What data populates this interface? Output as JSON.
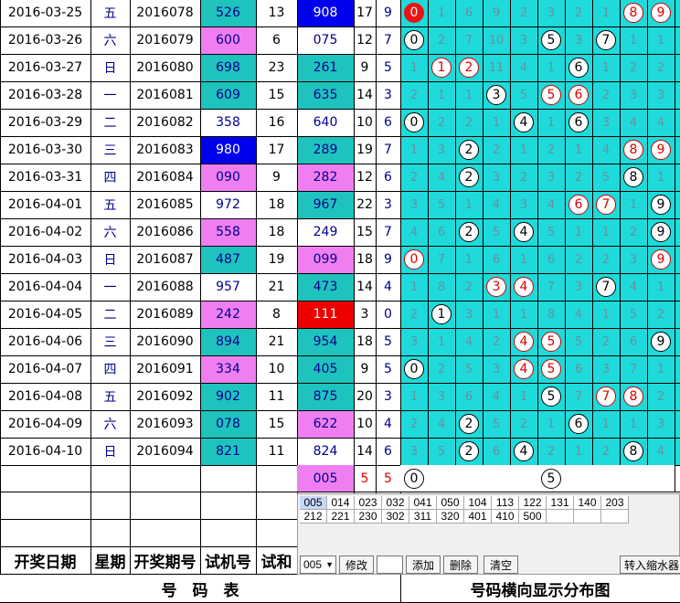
{
  "rows": [
    {
      "date": "2016-03-25",
      "weekday": "五",
      "issue": "2016078",
      "trial": "526",
      "sum": "13",
      "draw": "908",
      "s1": "17",
      "s2": "9",
      "trial_bg": "cyan",
      "draw_bg": "blue",
      "dist": [
        "0",
        "1",
        "6",
        "9",
        "2",
        "3",
        "2",
        "1",
        "8",
        "9"
      ],
      "marks": {
        "0": "fill",
        "8": "red",
        "9": "red"
      }
    },
    {
      "date": "2016-03-26",
      "weekday": "六",
      "issue": "2016079",
      "trial": "600",
      "sum": "6",
      "draw": "075",
      "s1": "12",
      "s2": "7",
      "trial_bg": "pink",
      "draw_bg": "none",
      "dist": [
        "0",
        "2",
        "7",
        "10",
        "3",
        "5",
        "3",
        "7",
        "1",
        "1"
      ],
      "marks": {
        "0": "black",
        "5": "black",
        "7": "black"
      }
    },
    {
      "date": "2016-03-27",
      "weekday": "日",
      "issue": "2016080",
      "trial": "698",
      "sum": "23",
      "draw": "261",
      "s1": "9",
      "s2": "5",
      "trial_bg": "cyan",
      "draw_bg": "cyan",
      "dist": [
        "1",
        "1",
        "2",
        "11",
        "4",
        "1",
        "6",
        "1",
        "2",
        "2"
      ],
      "marks": {
        "1": "red",
        "2": "red",
        "6": "black"
      }
    },
    {
      "date": "2016-03-28",
      "weekday": "一",
      "issue": "2016081",
      "trial": "609",
      "sum": "15",
      "draw": "635",
      "s1": "14",
      "s2": "3",
      "trial_bg": "cyan",
      "draw_bg": "cyan",
      "dist": [
        "2",
        "1",
        "1",
        "3",
        "5",
        "5",
        "6",
        "2",
        "3",
        "3"
      ],
      "marks": {
        "3": "black",
        "5": "red",
        "6": "red"
      }
    },
    {
      "date": "2016-03-29",
      "weekday": "二",
      "issue": "2016082",
      "trial": "358",
      "sum": "16",
      "draw": "640",
      "s1": "10",
      "s2": "6",
      "trial_bg": "none",
      "draw_bg": "none",
      "dist": [
        "0",
        "2",
        "2",
        "1",
        "4",
        "1",
        "6",
        "3",
        "4",
        "4"
      ],
      "marks": {
        "0": "black",
        "4": "black",
        "6": "black"
      }
    },
    {
      "date": "2016-03-30",
      "weekday": "三",
      "issue": "2016083",
      "trial": "980",
      "sum": "17",
      "draw": "289",
      "s1": "19",
      "s2": "7",
      "trial_bg": "blue",
      "draw_bg": "cyan",
      "dist": [
        "1",
        "3",
        "2",
        "2",
        "1",
        "2",
        "1",
        "4",
        "8",
        "9"
      ],
      "marks": {
        "2": "black",
        "8": "red",
        "9": "red"
      }
    },
    {
      "date": "2016-03-31",
      "weekday": "四",
      "issue": "2016084",
      "trial": "090",
      "sum": "9",
      "draw": "282",
      "s1": "12",
      "s2": "6",
      "trial_bg": "pink",
      "draw_bg": "pink",
      "dist": [
        "2",
        "4",
        "2",
        "3",
        "2",
        "3",
        "2",
        "5",
        "8",
        "1"
      ],
      "marks": {
        "2": "black",
        "8": "black"
      }
    },
    {
      "date": "2016-04-01",
      "weekday": "五",
      "issue": "2016085",
      "trial": "972",
      "sum": "18",
      "draw": "967",
      "s1": "22",
      "s2": "3",
      "trial_bg": "none",
      "draw_bg": "cyan",
      "dist": [
        "3",
        "5",
        "1",
        "4",
        "3",
        "4",
        "6",
        "7",
        "1",
        "9"
      ],
      "marks": {
        "6": "red",
        "7": "red",
        "9": "black"
      }
    },
    {
      "date": "2016-04-02",
      "weekday": "六",
      "issue": "2016086",
      "trial": "558",
      "sum": "18",
      "draw": "249",
      "s1": "15",
      "s2": "7",
      "trial_bg": "pink",
      "draw_bg": "none",
      "dist": [
        "4",
        "6",
        "2",
        "5",
        "4",
        "5",
        "1",
        "1",
        "2",
        "9"
      ],
      "marks": {
        "2": "black",
        "4": "black",
        "9": "black"
      }
    },
    {
      "date": "2016-04-03",
      "weekday": "日",
      "issue": "2016087",
      "trial": "487",
      "sum": "19",
      "draw": "099",
      "s1": "18",
      "s2": "9",
      "trial_bg": "cyan",
      "draw_bg": "pink",
      "dist": [
        "0",
        "7",
        "1",
        "6",
        "1",
        "6",
        "2",
        "2",
        "3",
        "9"
      ],
      "marks": {
        "0": "red",
        "9": "red"
      }
    },
    {
      "date": "2016-04-04",
      "weekday": "一",
      "issue": "2016088",
      "trial": "957",
      "sum": "21",
      "draw": "473",
      "s1": "14",
      "s2": "4",
      "trial_bg": "none",
      "draw_bg": "cyan",
      "dist": [
        "1",
        "8",
        "2",
        "3",
        "4",
        "7",
        "3",
        "7",
        "4",
        "1"
      ],
      "marks": {
        "3": "red",
        "4": "red",
        "7": "black"
      }
    },
    {
      "date": "2016-04-05",
      "weekday": "二",
      "issue": "2016089",
      "trial": "242",
      "sum": "8",
      "draw": "111",
      "s1": "3",
      "s2": "0",
      "trial_bg": "pink",
      "draw_bg": "red",
      "dist": [
        "2",
        "1",
        "3",
        "1",
        "1",
        "8",
        "4",
        "1",
        "5",
        "2"
      ],
      "marks": {
        "1": "black"
      }
    },
    {
      "date": "2016-04-06",
      "weekday": "三",
      "issue": "2016090",
      "trial": "894",
      "sum": "21",
      "draw": "954",
      "s1": "18",
      "s2": "5",
      "trial_bg": "cyan",
      "draw_bg": "cyan",
      "dist": [
        "3",
        "1",
        "4",
        "2",
        "4",
        "5",
        "5",
        "2",
        "6",
        "9"
      ],
      "marks": {
        "4": "red",
        "5": "red",
        "9": "black"
      }
    },
    {
      "date": "2016-04-07",
      "weekday": "四",
      "issue": "2016091",
      "trial": "334",
      "sum": "10",
      "draw": "405",
      "s1": "9",
      "s2": "5",
      "trial_bg": "pink",
      "draw_bg": "cyan",
      "dist": [
        "0",
        "2",
        "5",
        "3",
        "4",
        "5",
        "6",
        "3",
        "7",
        "1"
      ],
      "marks": {
        "0": "black",
        "4": "red",
        "5": "red"
      }
    },
    {
      "date": "2016-04-08",
      "weekday": "五",
      "issue": "2016092",
      "trial": "902",
      "sum": "11",
      "draw": "875",
      "s1": "20",
      "s2": "3",
      "trial_bg": "cyan",
      "draw_bg": "cyan",
      "dist": [
        "1",
        "3",
        "6",
        "4",
        "1",
        "5",
        "7",
        "7",
        "8",
        "2"
      ],
      "marks": {
        "5": "black",
        "7": "red",
        "8": "red"
      }
    },
    {
      "date": "2016-04-09",
      "weekday": "六",
      "issue": "2016093",
      "trial": "078",
      "sum": "15",
      "draw": "622",
      "s1": "10",
      "s2": "4",
      "trial_bg": "cyan",
      "draw_bg": "pink",
      "dist": [
        "2",
        "4",
        "2",
        "5",
        "2",
        "1",
        "6",
        "1",
        "1",
        "3"
      ],
      "marks": {
        "2": "black",
        "6": "black"
      }
    },
    {
      "date": "2016-04-10",
      "weekday": "日",
      "issue": "2016094",
      "trial": "821",
      "sum": "11",
      "draw": "824",
      "s1": "14",
      "s2": "6",
      "trial_bg": "cyan",
      "draw_bg": "none",
      "dist": [
        "3",
        "5",
        "2",
        "6",
        "4",
        "2",
        "1",
        "2",
        "8",
        "4"
      ],
      "marks": {
        "2": "black",
        "4": "black",
        "8": "black"
      }
    }
  ],
  "pending": {
    "draw": "005",
    "s1": "5",
    "s2": "5",
    "dist": [
      "0",
      "",
      "",
      "",
      "",
      "5",
      "",
      "",
      "",
      ""
    ],
    "marks": {
      "0": "black",
      "5": "black"
    }
  },
  "panel": {
    "row1": [
      "005",
      "014",
      "023",
      "032",
      "041",
      "050",
      "104",
      "113",
      "122",
      "131",
      "140",
      "203"
    ],
    "row2": [
      "212",
      "221",
      "230",
      "302",
      "311",
      "320",
      "401",
      "410",
      "500",
      "",
      "",
      ""
    ],
    "select_value": "005",
    "modify_label": "修改",
    "add_label": "添加",
    "delete_label": "删除",
    "clear_label": "清空",
    "shrink_label": "转入缩水器"
  },
  "headers": {
    "date": "开奖日期",
    "weekday": "星期",
    "issue": "开奖期号",
    "trial": "试机号",
    "sum": "试和",
    "footer_left": "号　码　表",
    "footer_right": "号码横向显示分布图"
  },
  "colors": {
    "cyan": "#1fc3be",
    "pink": "#ef7ff0",
    "blue": "#0000ee",
    "red": "#ef0000"
  }
}
